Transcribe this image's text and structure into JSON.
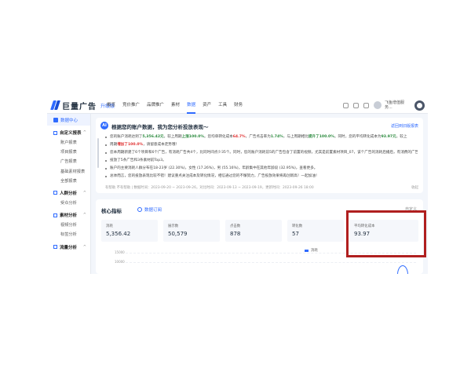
{
  "brand": {
    "name": "巨量广告",
    "tag": "升级版",
    "accent": "#2f6bff"
  },
  "topnav": {
    "items": [
      "概览",
      "竞价推广",
      "品牌推广",
      "素材",
      "数据",
      "资产",
      "工具",
      "财务"
    ],
    "active_index": 4,
    "user_line1": "飞鱼增值服务...",
    "user_line2": "账户名称"
  },
  "sidebar": {
    "home": "数据中心",
    "groups": [
      {
        "label": "自定义报表",
        "items": [
          "账户报表",
          "项目报表",
          "广告报表",
          "基础素材报表",
          "全部报表"
        ]
      },
      {
        "label": "人群分析",
        "items": [
          "受众分析"
        ]
      },
      {
        "label": "素材分析",
        "items": [
          "视频分析",
          "标签分析"
        ]
      },
      {
        "label": "流量分析",
        "items": []
      }
    ]
  },
  "ai_card": {
    "badge": "AI",
    "title": "根据您的账户数据，我为您分析投放表现～",
    "link": "返回到旧版报表",
    "lines": [
      {
        "a": "您的账户消耗达到了",
        "b": "5,356.42元",
        "c": "，较上周期",
        "d": "上涨100.0%",
        "e": "。您均单转化成本",
        "f": "64.7%",
        "g": "，广告点击率为",
        "h": "1.74%",
        "i": "，与上周期相比",
        "j": "提升了100.0%",
        "k": "。同时，您的平均转化成本为",
        "l": "93.97元",
        "m": "，较上"
      },
      {
        "a": "周期",
        "b": "增加了100.0%",
        "c": "，请留意成本走势哦！"
      },
      {
        "text": "您本周期新建了6个项目和6个广告，有消耗广告共4个，比同时间点少35个。同时，您的账户消耗前5的广告包含了前置的视频，尤其是前置素材项目_07，该个广告的消耗后播后，有消费的广告前置的机型..."
      },
      {
        "text": "投放了5条广告和3条素材前Top3。"
      },
      {
        "text": "账户的主要消耗人群分布在18-23岁 (22.30%)，女性 (17.26%)，男 (55.16%)，年龄集中在其他年龄段 (32.95%)，查看更多。"
      },
      {
        "text": "总体而言，您的投放表现比较不错！建议重点关注成本及转化情况，相信通过您的不懈努力，广告投放效果将再创新高！一起加油！"
      }
    ],
    "footer": "有帮助  不有帮助  |  数据时间：2023-09-20 ~ 2023-09-26，对比时间：2023-09-13 ~ 2023-09-19，更新时间：2023-09-26 18:00",
    "collapse": "收起"
  },
  "core_card": {
    "title": "核心指标",
    "subscribe": "数据订阅",
    "more": "自定义",
    "metrics": [
      {
        "label": "消耗",
        "value": "5,356.42"
      },
      {
        "label": "展示数",
        "value": "50,579"
      },
      {
        "label": "点击数",
        "value": "878"
      },
      {
        "label": "转化数",
        "value": "57"
      },
      {
        "label": "平均转化成本",
        "value": "93.97"
      }
    ],
    "legend": "消耗",
    "yticks": [
      "15000",
      "10000"
    ]
  },
  "highlight_color": "#b01f1f"
}
